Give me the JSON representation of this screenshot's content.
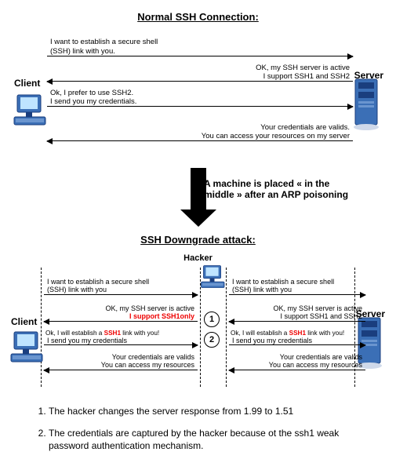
{
  "titles": {
    "top": "Normal SSH Connection:",
    "bottom": "SSH Downgrade attack:"
  },
  "labels": {
    "client": "Client",
    "server": "Server",
    "hacker": "Hacker"
  },
  "transition_text": "A machine is placed « in the middle » after an ARP poisoning",
  "normal_flow": [
    {
      "dir": "right",
      "lines": [
        "I want to establish a secure shell",
        "(SSH) link with you."
      ]
    },
    {
      "dir": "left",
      "lines": [
        "OK, my SSH server is active",
        "I support SSH1 and SSH2"
      ]
    },
    {
      "dir": "right",
      "lines": [
        "Ok, I prefer to use SSH2.",
        "I send you my credentials."
      ]
    },
    {
      "dir": "left",
      "lines": [
        "Your credentials are valids.",
        "You can access your resources on my server"
      ]
    }
  ],
  "attack_flow_left": [
    {
      "dir": "right",
      "lines": [
        "I want to establish a secure shell",
        "(SSH) link with you"
      ]
    },
    {
      "dir": "left",
      "lines": [
        "OK, my SSH server is active",
        "I support SSH1only"
      ],
      "red_index": 1
    },
    {
      "dir": "right",
      "lines": [
        "Ok, I will establish a SSH1 link with you!",
        "I send you my credentials"
      ],
      "red_word": "SSH1"
    },
    {
      "dir": "left",
      "lines": [
        "Your credentials are valids",
        "You can access my resources"
      ]
    }
  ],
  "attack_flow_right": [
    {
      "dir": "right",
      "lines": [
        "I want to establish a secure shell",
        "(SSH) link with you"
      ]
    },
    {
      "dir": "left",
      "lines": [
        "OK, my SSH server is active",
        "I support SSH1 and SSH2"
      ]
    },
    {
      "dir": "right",
      "lines": [
        "Ok, I will establish a SSH1 link with you!",
        "I send you my credentials"
      ],
      "red_word": "SSH1"
    },
    {
      "dir": "left",
      "lines": [
        "Your credentials are valids",
        "You can access my resources"
      ]
    }
  ],
  "circle_labels": {
    "c1": "1",
    "c2": "2"
  },
  "notes": [
    "The hacker changes the server response from 1.99 to 1.51",
    "The credentials are captured by the hacker because ot the ssh1 weak password authentication mechanism."
  ],
  "colors": {
    "blue": "#3b6fb6",
    "darkblue": "#1a3e7e",
    "screen": "#9fd0ff",
    "red": "#e00000"
  }
}
